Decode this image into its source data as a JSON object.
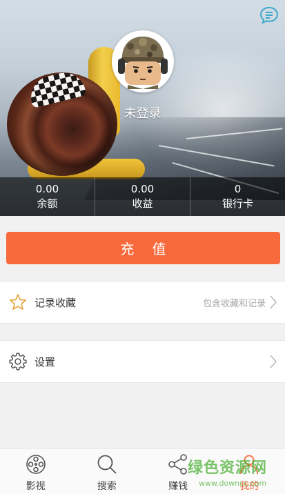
{
  "header": {
    "login_text": "未登录",
    "stats": [
      {
        "value": "0.00",
        "label": "余额"
      },
      {
        "value": "0.00",
        "label": "收益"
      },
      {
        "value": "0",
        "label": "银行卡"
      }
    ]
  },
  "recharge": {
    "label": "充 值"
  },
  "menu": [
    {
      "label": "记录收藏",
      "hint": "包含收藏和记录",
      "icon": "star-icon"
    },
    {
      "label": "设置",
      "hint": "",
      "icon": "gear-icon"
    }
  ],
  "tabbar": {
    "active": 3,
    "tabs": [
      {
        "label": "影视",
        "icon": "film-reel-icon"
      },
      {
        "label": "搜索",
        "icon": "search-icon"
      },
      {
        "label": "赚钱",
        "icon": "share-icon"
      },
      {
        "label": "我的",
        "icon": "user-icon"
      }
    ]
  },
  "watermark": {
    "main": "绿色资源网",
    "url": "www.downcc.com"
  },
  "colors": {
    "accent": "#f86a3c",
    "background": "#f1f1f1",
    "text": "#333333",
    "hint": "#a4a4a4",
    "watermark": "#4eb037"
  }
}
